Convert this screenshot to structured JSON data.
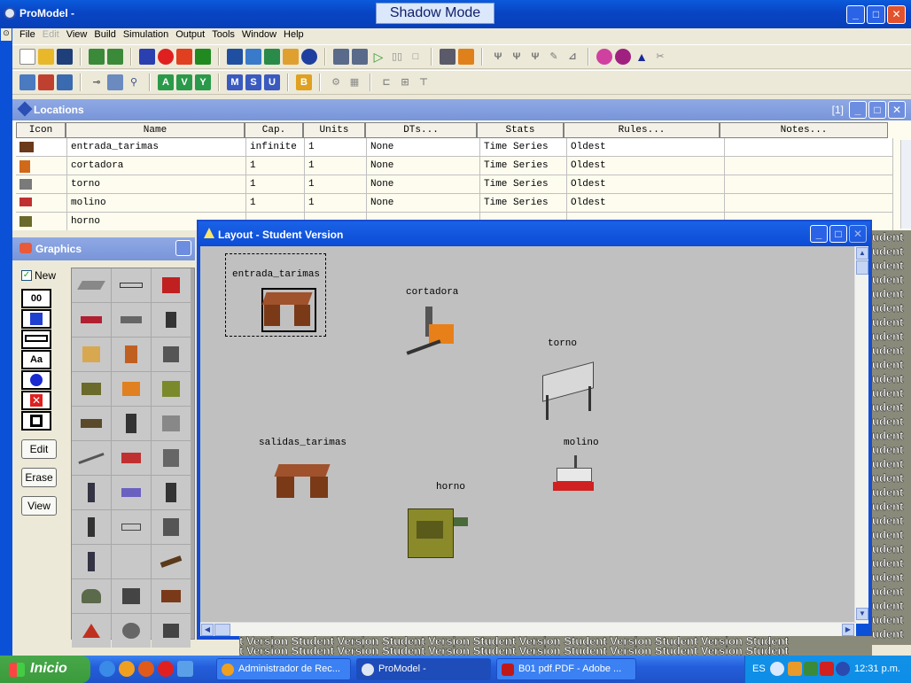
{
  "app": {
    "title": "ProModel -",
    "shadow_mode": "Shadow Mode"
  },
  "menu": [
    "File",
    "Edit",
    "View",
    "Build",
    "Simulation",
    "Output",
    "Tools",
    "Window",
    "Help"
  ],
  "locations": {
    "title": "Locations",
    "window_index": "[1]",
    "columns": [
      "Icon",
      "Name",
      "Cap.",
      "Units",
      "DTs...",
      "Stats",
      "Rules...",
      "Notes..."
    ],
    "rows": [
      {
        "name": "entrada_tarimas",
        "cap": "infinite",
        "units": "1",
        "dts": "None",
        "stats": "Time Series",
        "rules": "Oldest"
      },
      {
        "name": "cortadora",
        "cap": "1",
        "units": "1",
        "dts": "None",
        "stats": "Time Series",
        "rules": "Oldest"
      },
      {
        "name": "torno",
        "cap": "1",
        "units": "1",
        "dts": "None",
        "stats": "Time Series",
        "rules": "Oldest"
      },
      {
        "name": "molino",
        "cap": "1",
        "units": "1",
        "dts": "None",
        "stats": "Time Series",
        "rules": "Oldest"
      },
      {
        "name": "horno",
        "cap": "",
        "units": "",
        "dts": "",
        "stats": "",
        "rules": ""
      }
    ]
  },
  "graphics": {
    "title": "Graphics",
    "new_label": "New",
    "tools": [
      "00",
      "",
      "",
      "Aa",
      "",
      "",
      ""
    ],
    "buttons": {
      "edit": "Edit",
      "erase": "Erase",
      "view": "View"
    }
  },
  "layout": {
    "title": "Layout - Student Version",
    "labels": {
      "entrada": "entrada_tarimas",
      "cortadora": "cortadora",
      "torno": "torno",
      "salidas": "salidas_tarimas",
      "molino": "molino",
      "horno": "horno"
    }
  },
  "watermark": {
    "side": "udent",
    "bottom": "t Version Student Version Student Version Student Version Student Version Student Version Student"
  },
  "taskbar": {
    "start": "Inicio",
    "tasks": [
      "Administrador de Rec...",
      "ProModel -",
      "B01 pdf.PDF - Adobe ..."
    ],
    "lang": "ES",
    "clock": "12:31 p.m."
  }
}
